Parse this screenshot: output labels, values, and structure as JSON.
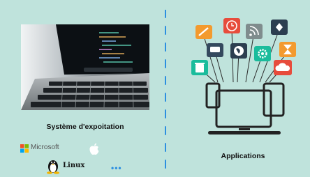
{
  "left": {
    "os_heading": "Système d'expoitation",
    "microsoft_label": "Microsoft",
    "linux_label": "Linux",
    "more_label": "•••"
  },
  "right": {
    "apps_heading": "Applications"
  },
  "colors": {
    "background": "#bfe3dc",
    "divider": "#2d8fe0",
    "screen_outline": "#222222",
    "ms_red": "#f25022",
    "ms_green": "#7fba00",
    "ms_blue": "#00a4ef",
    "ms_yellow": "#ffb900"
  },
  "icons": [
    "pencil-icon",
    "clock-icon",
    "rss-icon",
    "pin-icon",
    "chat-icon",
    "globe-icon",
    "gear-icon",
    "hourglass-icon",
    "trash-icon",
    "cloud-icon",
    "apple-icon",
    "linux-icon",
    "microsoft-icon"
  ]
}
